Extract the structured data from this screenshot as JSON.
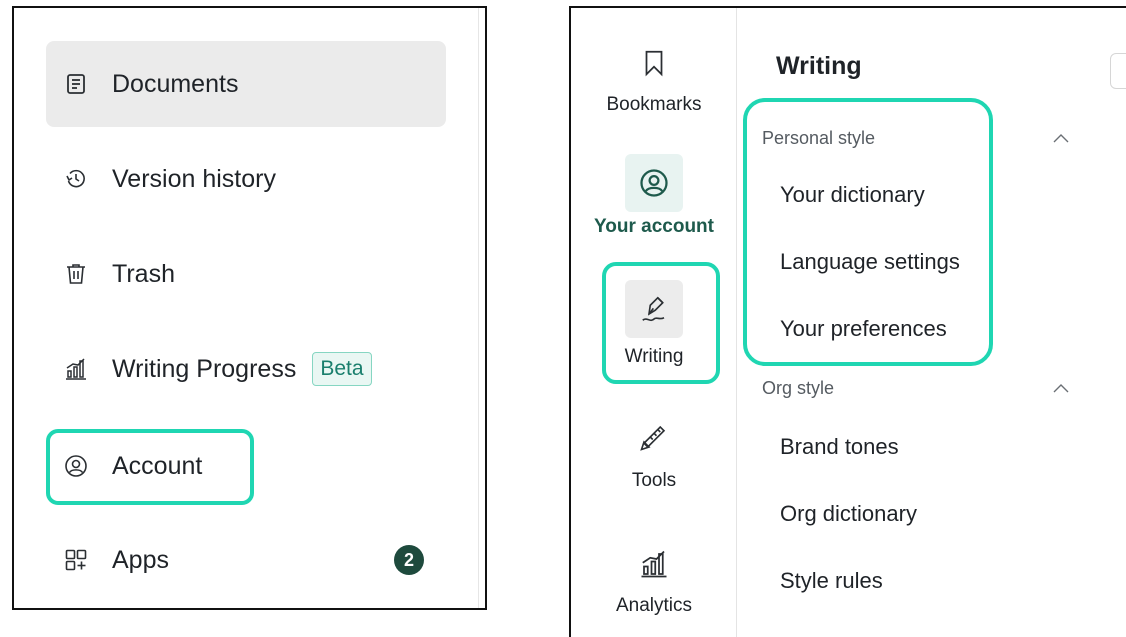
{
  "left_nav": {
    "items": [
      {
        "label": "Documents",
        "icon": "document-icon"
      },
      {
        "label": "Version history",
        "icon": "history-icon"
      },
      {
        "label": "Trash",
        "icon": "trash-icon"
      },
      {
        "label": "Writing Progress",
        "icon": "bar-chart-icon",
        "badge": "Beta"
      },
      {
        "label": "Account",
        "icon": "account-icon"
      },
      {
        "label": "Apps",
        "icon": "apps-icon",
        "count": "2"
      }
    ]
  },
  "rail": {
    "items": [
      {
        "label": "Bookmarks",
        "icon": "bookmark-icon"
      },
      {
        "label": "Your account",
        "icon": "account-icon"
      },
      {
        "label": "Writing",
        "icon": "pen-icon"
      },
      {
        "label": "Tools",
        "icon": "ruler-pencil-icon"
      },
      {
        "label": "Analytics",
        "icon": "bar-chart-icon"
      }
    ]
  },
  "writing_panel": {
    "title": "Writing",
    "sections": [
      {
        "title": "Personal style",
        "items": [
          "Your dictionary",
          "Language settings",
          "Your preferences"
        ]
      },
      {
        "title": "Org style",
        "items": [
          "Brand tones",
          "Org dictionary",
          "Style rules"
        ]
      }
    ]
  },
  "colors": {
    "highlight": "#1fd6b2",
    "active_item_bg": "#ebebeb",
    "badge_dark": "#1e4a3d",
    "beta_text": "#1a7f6d",
    "account_accent": "#1e5a4c"
  }
}
